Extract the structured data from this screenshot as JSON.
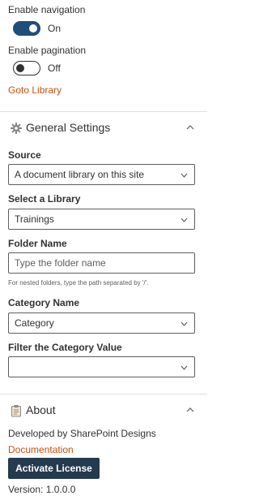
{
  "navigation": {
    "label": "Enable navigation",
    "toggle_state": "On"
  },
  "pagination": {
    "label": "Enable pagination",
    "toggle_state": "Off"
  },
  "goto_library_link": "Goto Library",
  "general_settings": {
    "title": "General Settings",
    "source": {
      "label": "Source",
      "value": "A document library on this site"
    },
    "library": {
      "label": "Select a Library",
      "value": "Trainings"
    },
    "folder": {
      "label": "Folder Name",
      "placeholder": "Type the folder name",
      "value": "",
      "hint": "For nested folders, type the path separated by '/'."
    },
    "category": {
      "label": "Category Name",
      "value": "Category"
    },
    "filter": {
      "label": "Filter the Category Value",
      "value": ""
    }
  },
  "about": {
    "title": "About",
    "developed_by": "Developed by SharePoint Designs",
    "documentation_link": "Documentation",
    "activate_button": "Activate License",
    "version": "Version: 1.0.0.0"
  },
  "colors": {
    "accent_link": "#ca5010",
    "toggle_on": "#1f4e79",
    "button_bg": "#243a4f"
  }
}
